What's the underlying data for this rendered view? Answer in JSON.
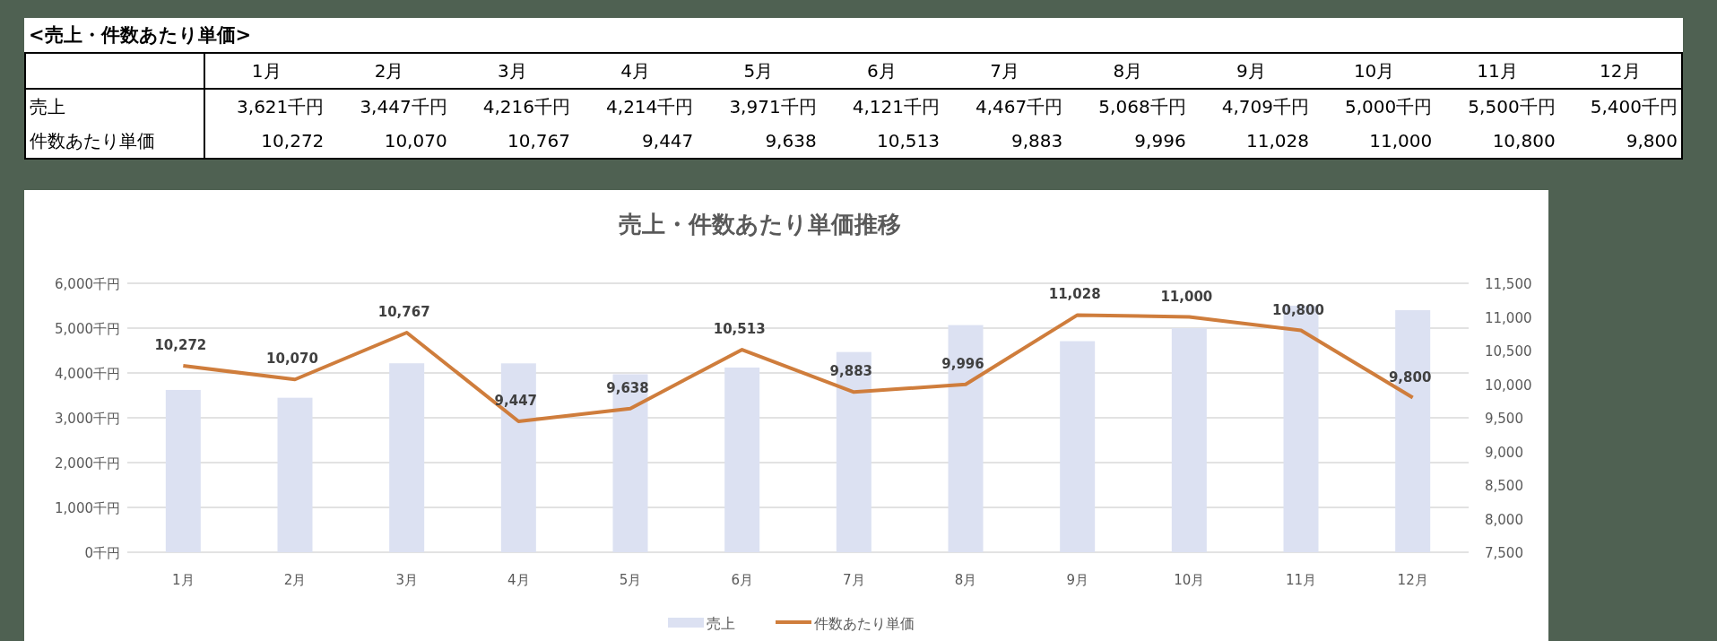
{
  "table": {
    "title": "<売上・件数あたり単価>",
    "columns": [
      "1月",
      "2月",
      "3月",
      "4月",
      "5月",
      "6月",
      "7月",
      "8月",
      "9月",
      "10月",
      "11月",
      "12月"
    ],
    "rows": [
      {
        "label": "売上",
        "values": [
          "3,621千円",
          "3,447千円",
          "4,216千円",
          "4,214千円",
          "3,971千円",
          "4,121千円",
          "4,467千円",
          "5,068千円",
          "4,709千円",
          "5,000千円",
          "5,500千円",
          "5,400千円"
        ]
      },
      {
        "label": "件数あたり単価",
        "values": [
          "10,272",
          "10,070",
          "10,767",
          "9,447",
          "9,638",
          "10,513",
          "9,883",
          "9,996",
          "11,028",
          "11,000",
          "10,800",
          "9,800"
        ]
      }
    ]
  },
  "chart": {
    "chart_data": {
      "type": "bar",
      "title": "売上・件数あたり単価推移",
      "categories": [
        "1月",
        "2月",
        "3月",
        "4月",
        "5月",
        "6月",
        "7月",
        "8月",
        "9月",
        "10月",
        "11月",
        "12月"
      ],
      "series": [
        {
          "name": "売上",
          "color": "#dce1f2",
          "values": [
            3621,
            3447,
            4216,
            4214,
            3971,
            4121,
            4467,
            5068,
            4709,
            5000,
            5500,
            5400
          ]
        },
        {
          "name": "件数あたり単価",
          "type": "line",
          "axis": "y2",
          "color": "#cf7d3c",
          "values": [
            10272,
            10070,
            10767,
            9447,
            9638,
            10513,
            9883,
            9996,
            11028,
            11000,
            10800,
            9800
          ],
          "value_labels": [
            "10,272",
            "10,070",
            "10,767",
            "9,447",
            "9,638",
            "10,513",
            "9,883",
            "9,996",
            "11,028",
            "11,000",
            "10,800",
            "9,800"
          ]
        }
      ],
      "grid": true,
      "legend": "bottom",
      "ylim": [
        0,
        6000
      ],
      "yticks": [
        {
          "value": 0,
          "label": "0千円"
        },
        {
          "value": 1000,
          "label": "1,000千円"
        },
        {
          "value": 2000,
          "label": "2,000千円"
        },
        {
          "value": 3000,
          "label": "3,000千円"
        },
        {
          "value": 4000,
          "label": "4,000千円"
        },
        {
          "value": 5000,
          "label": "5,000千円"
        },
        {
          "value": 6000,
          "label": "6,000千円"
        }
      ],
      "y2lim": [
        7500,
        11500
      ],
      "y2ticks": [
        {
          "value": 7500,
          "label": "7,500"
        },
        {
          "value": 8000,
          "label": "8,000"
        },
        {
          "value": 8500,
          "label": "8,500"
        },
        {
          "value": 9000,
          "label": "9,000"
        },
        {
          "value": 9500,
          "label": "9,500"
        },
        {
          "value": 10000,
          "label": "10,000"
        },
        {
          "value": 10500,
          "label": "10,500"
        },
        {
          "value": 11000,
          "label": "11,000"
        },
        {
          "value": 11500,
          "label": "11,500"
        }
      ]
    }
  }
}
